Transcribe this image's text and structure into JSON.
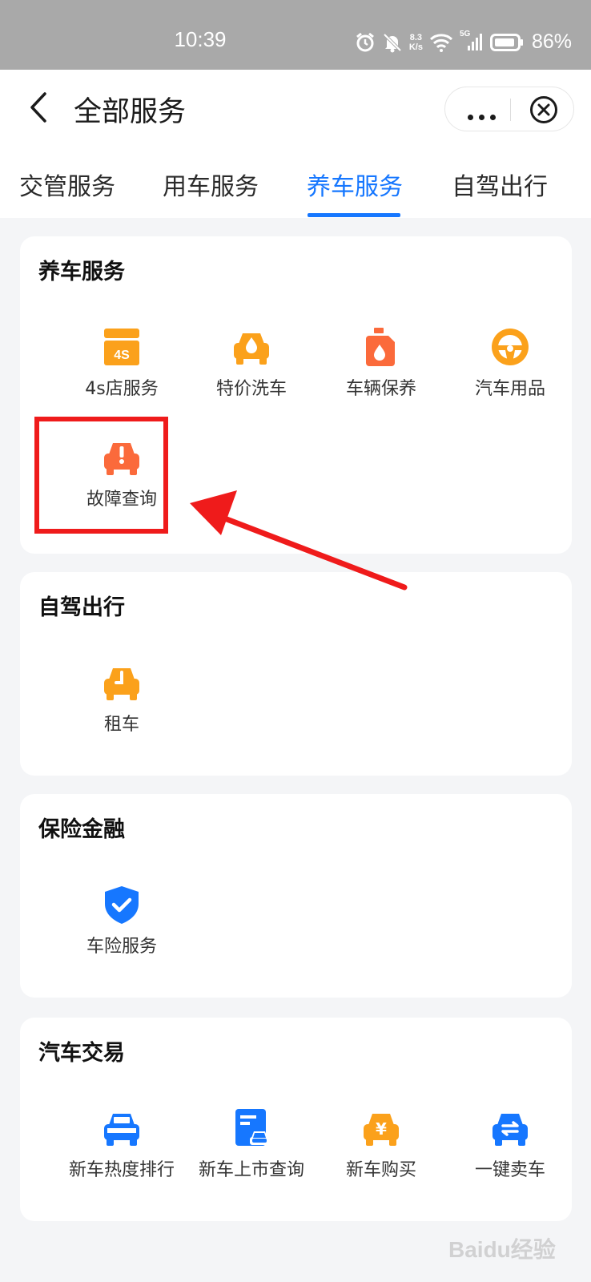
{
  "status_bar": {
    "time": "10:39",
    "net_speed_value": "8.3",
    "net_speed_unit": "K/s",
    "signal_label": "5G",
    "battery": "86%"
  },
  "header": {
    "title": "全部服务"
  },
  "tabs": [
    {
      "label": "交管服务",
      "active": false
    },
    {
      "label": "用车服务",
      "active": false
    },
    {
      "label": "养车服务",
      "active": true
    },
    {
      "label": "自驾出行",
      "active": false
    }
  ],
  "sections": [
    {
      "title": "养车服务",
      "items": [
        {
          "label": "4s店服务",
          "icon": "4s-store-icon",
          "icon_text": "4S"
        },
        {
          "label": "特价洗车",
          "icon": "car-wash-icon"
        },
        {
          "label": "车辆保养",
          "icon": "oil-bottle-icon"
        },
        {
          "label": "汽车用品",
          "icon": "steering-wheel-icon"
        },
        {
          "label": "故障查询",
          "icon": "car-fault-icon"
        }
      ]
    },
    {
      "title": "自驾出行",
      "items": [
        {
          "label": "租车",
          "icon": "car-rental-icon"
        }
      ]
    },
    {
      "title": "保险金融",
      "items": [
        {
          "label": "车险服务",
          "icon": "shield-check-icon"
        }
      ]
    },
    {
      "title": "汽车交易",
      "items": [
        {
          "label": "新车热度排行",
          "icon": "car-ranking-icon"
        },
        {
          "label": "新车上市查询",
          "icon": "new-car-document-icon"
        },
        {
          "label": "新车购买",
          "icon": "car-yen-icon",
          "icon_text": "¥"
        },
        {
          "label": "一键卖车",
          "icon": "car-exchange-icon"
        }
      ]
    }
  ],
  "watermark": "Baidu经验",
  "colors": {
    "accent_blue": "#1677ff",
    "orange": "#fba11b",
    "orange_red": "#fb6a3b",
    "annotation_red": "#ef1b1b",
    "status_bar_bg": "#a9a9a9"
  }
}
